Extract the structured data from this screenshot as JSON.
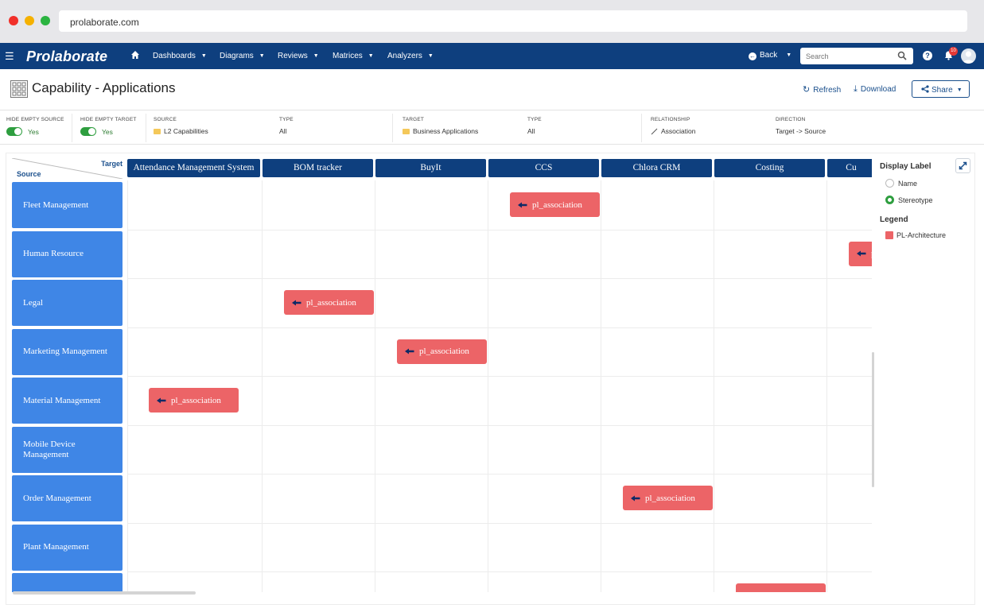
{
  "browser": {
    "url": "prolaborate.com"
  },
  "navbar": {
    "brand": "Prolaborate",
    "items": [
      {
        "label": "Dashboards"
      },
      {
        "label": "Diagrams"
      },
      {
        "label": "Reviews"
      },
      {
        "label": "Matrices"
      },
      {
        "label": "Analyzers"
      }
    ],
    "back_label": "Back",
    "search_placeholder": "Search",
    "notification_count": "10"
  },
  "page": {
    "title": "Capability - Applications",
    "refresh_label": "Refresh",
    "download_label": "Download",
    "share_label": "Share"
  },
  "filters": {
    "hide_empty_source": {
      "label": "HIDE EMPTY SOURCE",
      "value": "Yes"
    },
    "hide_empty_target": {
      "label": "HIDE EMPTY TARGET",
      "value": "Yes"
    },
    "source": {
      "label": "SOURCE",
      "value": "L2 Capabilities"
    },
    "source_type": {
      "label": "TYPE",
      "value": "All"
    },
    "target": {
      "label": "TARGET",
      "value": "Business Applications"
    },
    "target_type": {
      "label": "TYPE",
      "value": "All"
    },
    "relationship": {
      "label": "RELATIONSHIP",
      "value": "Association"
    },
    "direction": {
      "label": "DIRECTION",
      "value": "Target -> Source"
    }
  },
  "matrix": {
    "corner_target": "Target",
    "corner_source": "Source",
    "columns": [
      "Attendance Management System",
      "BOM tracker",
      "BuyIt",
      "CCS",
      "Chlora CRM",
      "Costing",
      "Cu"
    ],
    "rows": [
      "Fleet Management",
      "Human Resource",
      "Legal",
      "Marketing Management",
      "Material Management",
      "Mobile Device Management",
      "Order Management",
      "Plant Management",
      ""
    ],
    "cells": [
      {
        "row": 0,
        "col": 3,
        "label": "pl_association"
      },
      {
        "row": 1,
        "col": 6,
        "label": "pl_association"
      },
      {
        "row": 2,
        "col": 1,
        "label": "pl_association"
      },
      {
        "row": 3,
        "col": 2,
        "label": "pl_association"
      },
      {
        "row": 4,
        "col": 0,
        "label": "pl_association"
      },
      {
        "row": 6,
        "col": 4,
        "label": "pl_association"
      },
      {
        "row": 8,
        "col": 5,
        "label": ""
      }
    ]
  },
  "side_panel": {
    "display_label_title": "Display Label",
    "options": [
      {
        "label": "Name",
        "selected": false
      },
      {
        "label": "Stereotype",
        "selected": true
      }
    ],
    "legend_title": "Legend",
    "legend_items": [
      {
        "label": "PL-Architecture",
        "color": "#ec6467"
      }
    ]
  },
  "colors": {
    "navbar": "#0e3f7e",
    "row_header": "#3f86e6",
    "chip": "#ec6467",
    "toggle_on": "#2e9e3f"
  }
}
